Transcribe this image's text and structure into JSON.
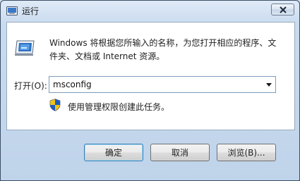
{
  "window": {
    "title": "运行",
    "description": "Windows 将根据您所输入的名称，为您打开相应的程序、文件夹、文档或 Internet 资源。",
    "open_label": "打开(O):",
    "command_value": "msconfig",
    "admin_note": "使用管理权限创建此任务。"
  },
  "buttons": {
    "ok": "确定",
    "cancel": "取消",
    "browse": "浏览(B)..."
  },
  "icons": {
    "app": "run-icon",
    "close": "close-icon",
    "dropdown": "chevron-down-icon",
    "shield": "uac-shield-icon"
  },
  "colors": {
    "frame": "#c9dbef",
    "close_x": "#1f2d3f",
    "shield_blue": "#1f5bbd",
    "shield_yellow": "#f2c41a"
  }
}
